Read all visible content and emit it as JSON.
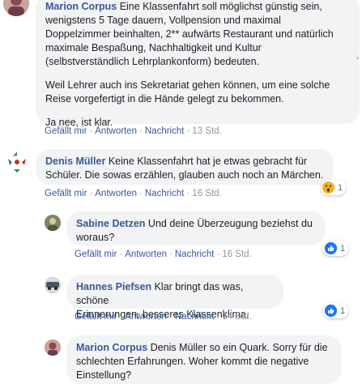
{
  "comments": [
    {
      "author": "Marion Corpus",
      "text1": "Eine Klassenfahrt soll möglichst günstig sein,",
      "text2": "wenigstens 5 Tage dauern, Vollpension und maximal",
      "text3": "Doppelzimmer beinhalten, 2** aufwärts Restaurant und natürlich",
      "text4": "maximale Bespaßung, Nachhaltigkeit und Kultur",
      "text5": "(selbstverständlich Lehrplankonform) bedeuten.",
      "text6": "Weil Lehrer auch ins Sekretariat gehen können, um eine solche",
      "text7": "Reise vorgefertigt in die Hände gelegt zu bekommen.",
      "text8": "Ja nee, ist klar.",
      "like": "Gefällt mir",
      "reply": "Antworten",
      "message": "Nachricht",
      "time": "13 Std."
    },
    {
      "author": "Denis Müller",
      "text1": "Keine Klassenfahrt hat je etwas gebracht für",
      "text2": "Schüler. Die sowas erzählen, glauben auch noch an Märchen.",
      "like": "Gefällt mir",
      "reply": "Antworten",
      "message": "Nachricht",
      "time": "16 Std.",
      "reaction_icon": "wow-icon",
      "reaction_count": "1"
    },
    {
      "author": "Sabine Detzen",
      "text1": "Und deine Überzeugung beziehst du",
      "text2": "woraus?",
      "like": "Gefällt mir",
      "reply": "Antworten",
      "message": "Nachricht",
      "time": "16 Std.",
      "reaction_icon": "thumbs-up-icon",
      "reaction_count": "1"
    },
    {
      "author": "Hannes Piefsen",
      "text1": "Klar bringt das was, schöne",
      "text2": "Erinnerungen, besseres Klassenklima.",
      "like": "Gefällt mir",
      "reply": "Antworten",
      "message": "Nachricht",
      "time": "14 Std.",
      "reaction_icon": "thumbs-up-icon",
      "reaction_count": "1"
    },
    {
      "author": "Marion Corpus",
      "text1": "Denis Müller so ein Quark. Sorry für die",
      "text2": "schlechten Erfahrungen. Woher kommt die negative",
      "text3": "Einstellung?"
    }
  ],
  "colors": {
    "link": "#385898",
    "bubble": "#f2f3f5",
    "meta": "#90949c",
    "like_blue": "#1877f2"
  }
}
